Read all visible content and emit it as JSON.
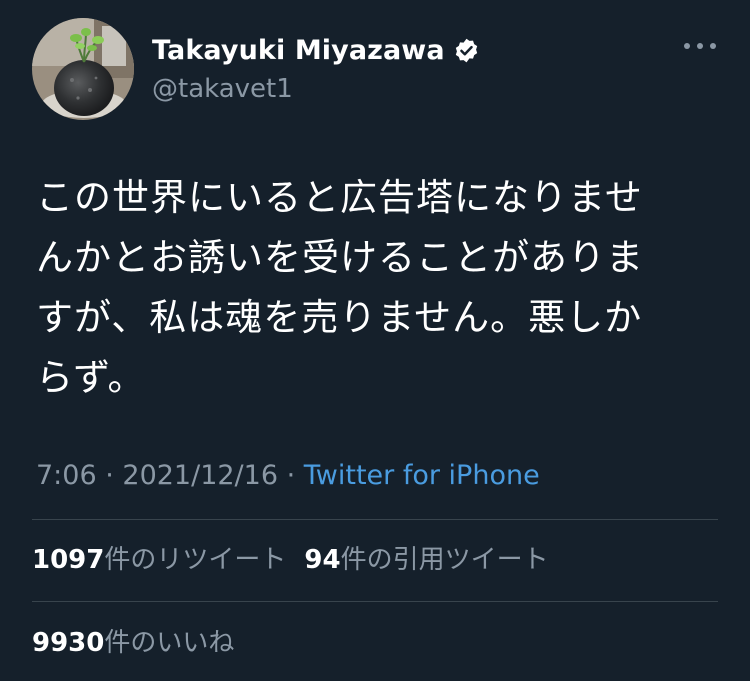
{
  "author": {
    "display_name": "Takayuki Miyazawa",
    "handle": "@takavet1",
    "verified": true
  },
  "tweet": {
    "text": "この世界にいると広告塔になりませ\nんかとお誘いを受けることがありま\nすが、私は魂を売りません。悪しか\nらず。",
    "time": "7:06",
    "separator1": " · ",
    "date": "2021/12/16",
    "separator2": " · ",
    "source": "Twitter for iPhone"
  },
  "stats": {
    "retweets_count": "1097",
    "retweets_label": "件のリツイート",
    "quotes_count": "94",
    "quotes_label": "件の引用ツイート",
    "likes_count": "9930",
    "likes_label": "件のいいね"
  },
  "colors": {
    "background": "#15202b",
    "text_primary": "#ffffff",
    "text_secondary": "#8b98a5",
    "link": "#4a9ce0",
    "divider": "#38444d"
  },
  "icons": {
    "verified": "verified-badge-icon",
    "more": "more-options-icon"
  }
}
